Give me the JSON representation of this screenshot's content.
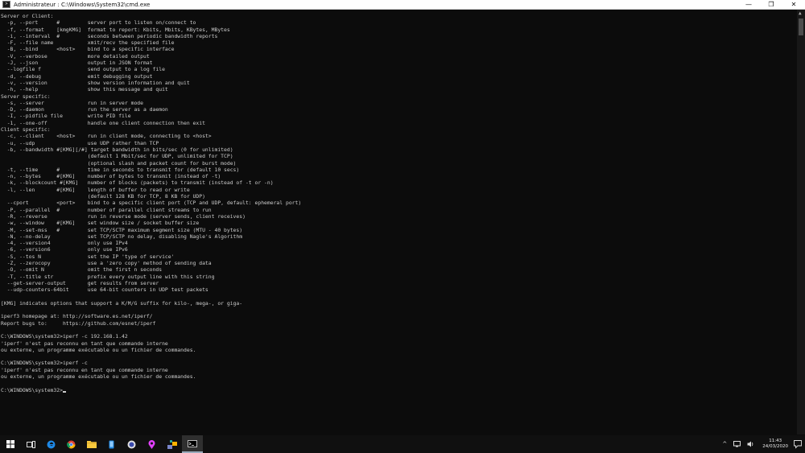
{
  "window": {
    "title": "Administrateur : C:\\Windows\\System32\\cmd.exe",
    "minimize_glyph": "—",
    "maximize_glyph": "❐",
    "close_glyph": "✕"
  },
  "console": {
    "lines": [
      "Server or Client:",
      "  -p, --port      #         server port to listen on/connect to",
      "  -f, --format    [kmgKMG]  format to report: Kbits, Mbits, KBytes, MBytes",
      "  -i, --interval  #         seconds between periodic bandwidth reports",
      "  -F, --file name           xmit/recv the specified file",
      "  -B, --bind      <host>    bind to a specific interface",
      "  -V, --verbose             more detailed output",
      "  -J, --json                output in JSON format",
      "  --logfile f               send output to a log file",
      "  -d, --debug               emit debugging output",
      "  -v, --version             show version information and quit",
      "  -h, --help                show this message and quit",
      "Server specific:",
      "  -s, --server              run in server mode",
      "  -D, --daemon              run the server as a daemon",
      "  -I, --pidfile file        write PID file",
      "  -1, --one-off             handle one client connection then exit",
      "Client specific:",
      "  -c, --client    <host>    run in client mode, connecting to <host>",
      "  -u, --udp                 use UDP rather than TCP",
      "  -b, --bandwidth #[KMG][/#] target bandwidth in bits/sec (0 for unlimited)",
      "                            (default 1 Mbit/sec for UDP, unlimited for TCP)",
      "                            (optional slash and packet count for burst mode)",
      "  -t, --time      #         time in seconds to transmit for (default 10 secs)",
      "  -n, --bytes     #[KMG]    number of bytes to transmit (instead of -t)",
      "  -k, --blockcount #[KMG]   number of blocks (packets) to transmit (instead of -t or -n)",
      "  -l, --len       #[KMG]    length of buffer to read or write",
      "                            (default 128 KB for TCP, 8 KB for UDP)",
      "  --cport         <port>    bind to a specific client port (TCP and UDP, default: ephemeral port)",
      "  -P, --parallel  #         number of parallel client streams to run",
      "  -R, --reverse             run in reverse mode (server sends, client receives)",
      "  -w, --window    #[KMG]    set window size / socket buffer size",
      "  -M, --set-mss   #         set TCP/SCTP maximum segment size (MTU - 40 bytes)",
      "  -N, --no-delay            set TCP/SCTP no delay, disabling Nagle's Algorithm",
      "  -4, --version4            only use IPv4",
      "  -6, --version6            only use IPv6",
      "  -S, --tos N               set the IP 'type of service'",
      "  -Z, --zerocopy            use a 'zero copy' method of sending data",
      "  -O, --omit N              omit the first n seconds",
      "  -T, --title str           prefix every output line with this string",
      "  --get-server-output       get results from server",
      "  --udp-counters-64bit      use 64-bit counters in UDP test packets",
      "",
      "[KMG] indicates options that support a K/M/G suffix for kilo-, mega-, or giga-",
      "",
      "iperf3 homepage at: http://software.es.net/iperf/",
      "Report bugs to:     https://github.com/esnet/iperf",
      "",
      "C:\\WINDOWS\\system32>iperf -c 192.168.1.42",
      "'iperf' n'est pas reconnu en tant que commande interne",
      "ou externe, un programme exécutable ou un fichier de commandes.",
      "",
      "C:\\WINDOWS\\system32>iperf -c",
      "'iperf' n'est pas reconnu en tant que commande interne",
      "ou externe, un programme exécutable ou un fichier de commandes.",
      ""
    ],
    "prompt": "C:\\WINDOWS\\system32>"
  },
  "taskbar": {
    "clock_time": "11:43",
    "clock_date": "24/03/2020",
    "tray_chevron": "^",
    "accent_color": "#0078d7"
  }
}
